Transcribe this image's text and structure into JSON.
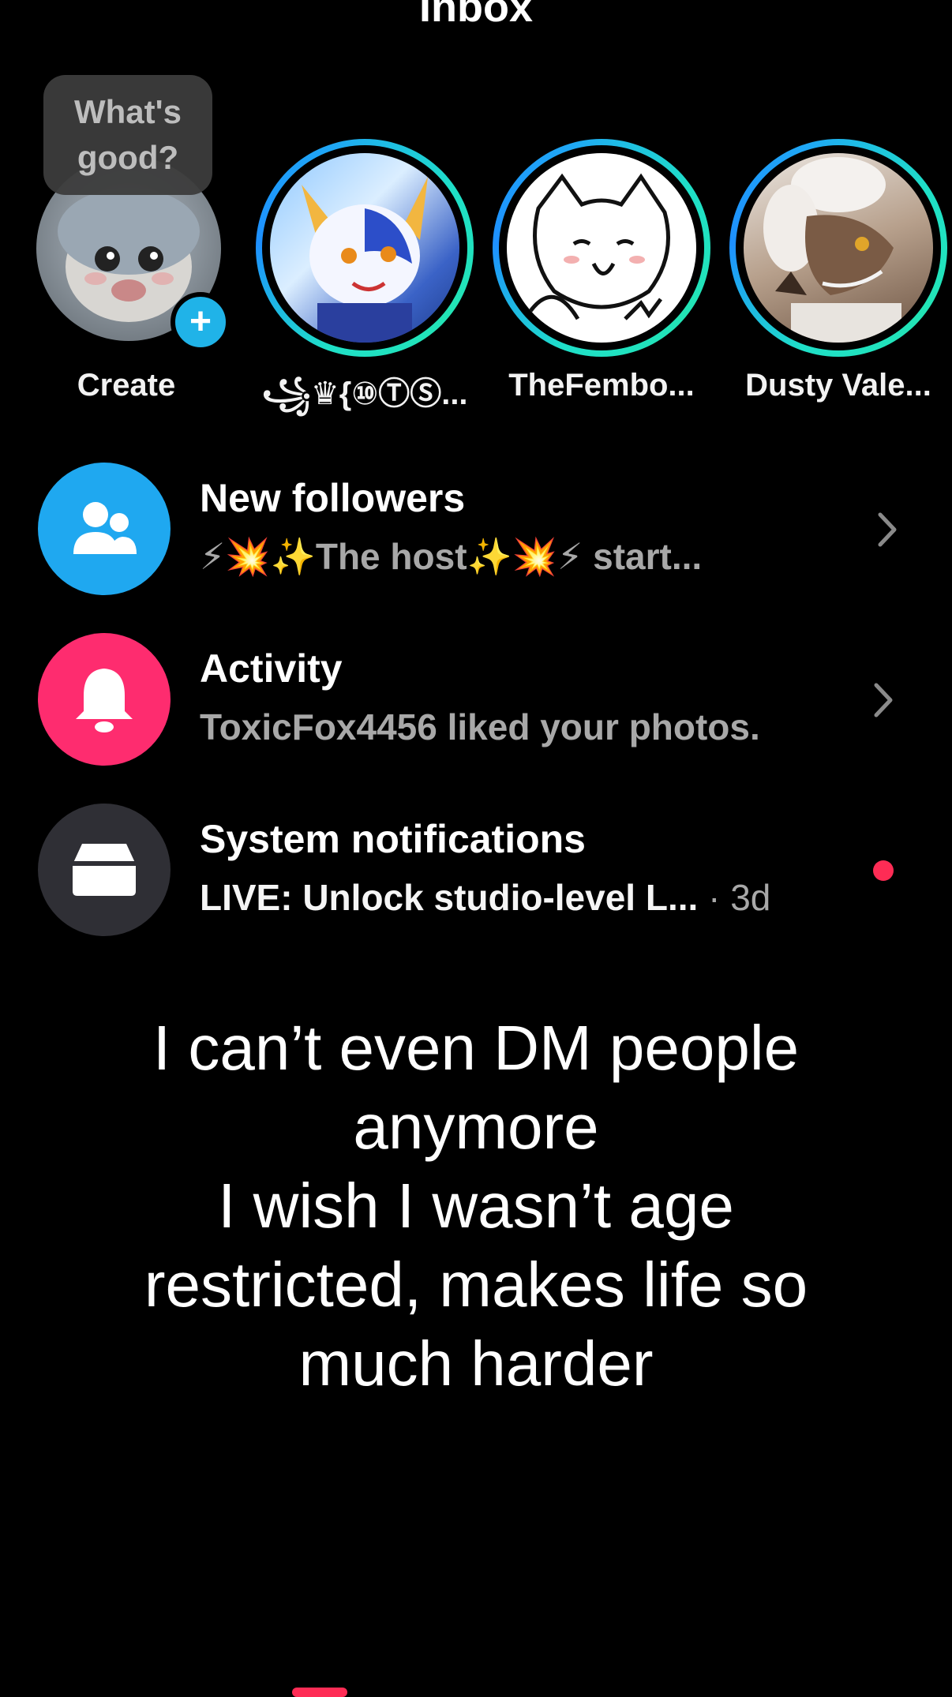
{
  "header": {
    "title": "Inbox"
  },
  "create": {
    "bubble_text": "What's good?",
    "label": "Create"
  },
  "stories": [
    {
      "label": "꧁♛{⑩ⓉⓈ..."
    },
    {
      "label": "TheFembo..."
    },
    {
      "label": "Dusty Vale..."
    }
  ],
  "rows": [
    {
      "title": "New followers",
      "subtitle": "⚡💥✨The host✨💥⚡ start...",
      "icon": "people-icon",
      "color": "#1fa8f0"
    },
    {
      "title": "Activity",
      "subtitle": "ToxicFox4456 liked your photos.",
      "icon": "bell-icon",
      "color": "#fe2c6f"
    },
    {
      "title": "System notifications",
      "subtitle": "LIVE: Unlock studio-level L...",
      "time": "· 3d",
      "icon": "inbox-tray-icon",
      "color": "#2f2f35"
    }
  ],
  "caption": {
    "line1": "I can’t even DM people",
    "line2": "anymore",
    "line3": "I wish I wasn’t age",
    "line4": "restricted, makes life so",
    "line5": "much harder"
  }
}
